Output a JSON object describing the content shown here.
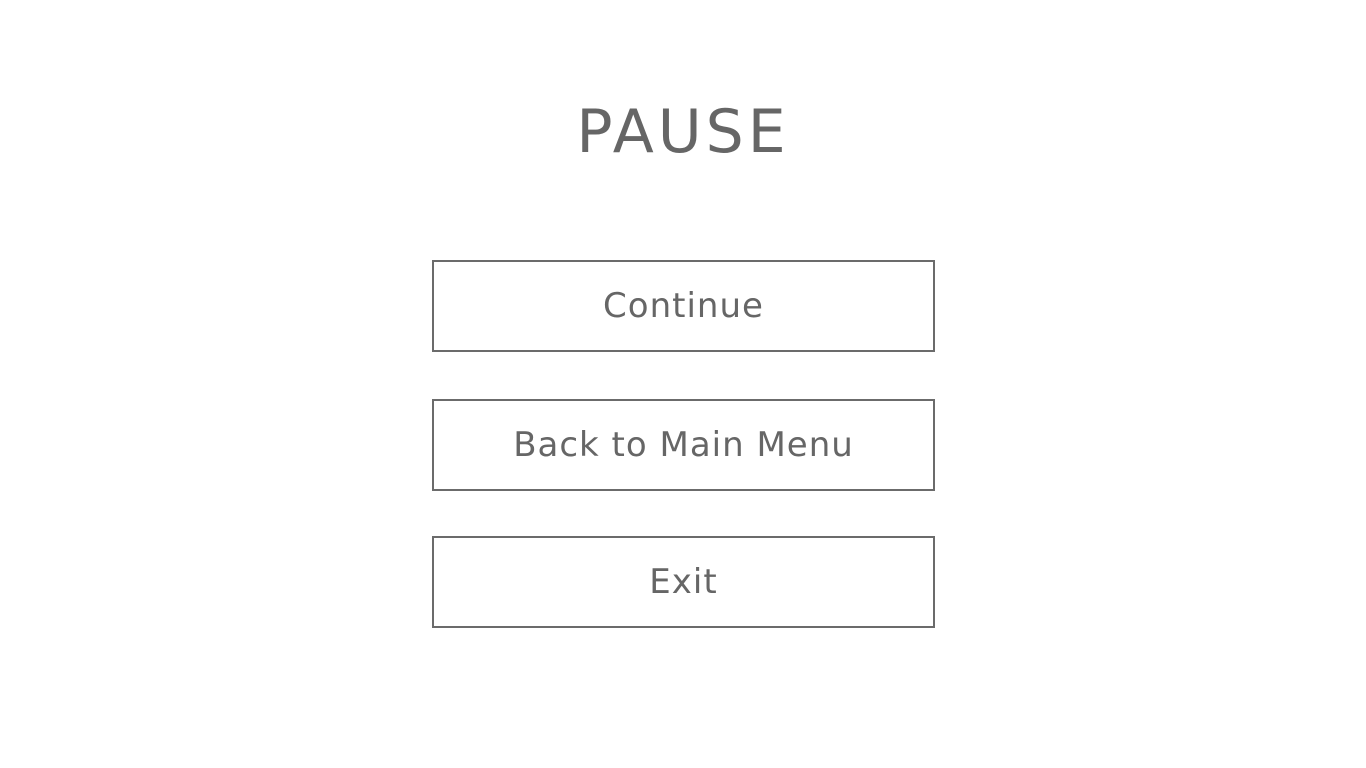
{
  "screen": {
    "title": "PAUSE",
    "background_color": "#ffffff",
    "text_color": "#666666",
    "border_color": "#6b6b6b"
  },
  "menu": {
    "items": [
      {
        "label": "Continue"
      },
      {
        "label": "Back to Main Menu"
      },
      {
        "label": "Exit"
      }
    ]
  }
}
